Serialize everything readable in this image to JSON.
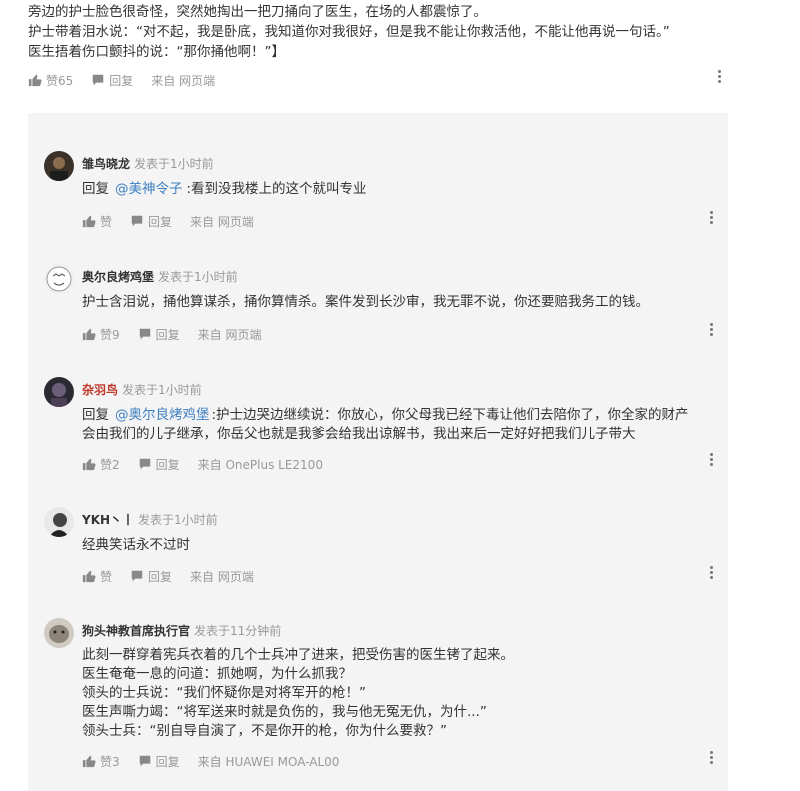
{
  "post": {
    "lines": [
      "旁边的护士脸色很奇怪，突然她掏出一把刀捅向了医生，在场的人都震惊了。",
      "护士带着泪水说：“对不起，我是卧底，我知道你对我很好，但是我不能让你救活他，不能让他再说一句话。”",
      "医生捂着伤口颤抖的说：“那你捅他啊！”】"
    ],
    "like_label": "赞65",
    "reply_label": "回复",
    "source": "来自 网页端"
  },
  "comments": [
    {
      "username": "雏鸟晓龙",
      "meta": "发表于1小时前",
      "reply_prefix": "回复",
      "mention": "@美神令子",
      "lines": [
        ":看到没我楼上的这个就叫专业"
      ],
      "like_label": "赞",
      "reply_label": "回复",
      "source": "来自 网页端"
    },
    {
      "username": "奥尔良烤鸡堡",
      "meta": "发表于1小时前",
      "lines": [
        "护士含泪说，捅他算谋杀，捅你算情杀。案件发到长沙审，我无罪不说，你还要赔我务工的钱。"
      ],
      "like_label": "赞9",
      "reply_label": "回复",
      "source": "来自 网页端"
    },
    {
      "username": "杂羽鸟",
      "meta": "发表于1小时前",
      "reply_prefix": "回复",
      "mention": "@奥尔良烤鸡堡",
      "lines": [
        ":护士边哭边继续说：你放心，你父母我已经下毒让他们去陪你了，你全家的财产",
        "会由我们的儿子继承，你岳父也就是我爹会给我出谅解书，我出来后一定好好把我们儿子带大"
      ],
      "like_label": "赞2",
      "reply_label": "回复",
      "source": "来自 OnePlus  LE2100"
    },
    {
      "username": "YKH丶丨",
      "meta": "发表于1小时前",
      "lines": [
        "经典笑话永不过时"
      ],
      "like_label": "赞",
      "reply_label": "回复",
      "source": "来自 网页端"
    },
    {
      "username": "狗头神教首席执行官",
      "meta": "发表于11分钟前",
      "lines": [
        "此刻一群穿着宪兵衣着的几个士兵冲了进来，把受伤害的医生铐了起来。",
        "医生奄奄一息的问道：抓她啊，为什么抓我？",
        "领头的士兵说：“我们怀疑你是对将军开的枪！”",
        "医生声嘶力竭：“将军送来时就是负伤的，我与他无冤无仇，为什...”",
        "领头士兵：“别自导自演了，不是你开的枪，你为什么要救？”"
      ],
      "like_label": "赞3",
      "reply_label": "回复",
      "source": "来自 HUAWEI  MOA-AL00"
    }
  ],
  "icons": {
    "like": "thumbs-up-icon",
    "reply": "comment-icon",
    "more": "more-vertical-icon"
  },
  "colors": {
    "mention": "#3d7fc1",
    "highlight_username": "#c0392b",
    "panel_bg": "#f4f4f4"
  }
}
